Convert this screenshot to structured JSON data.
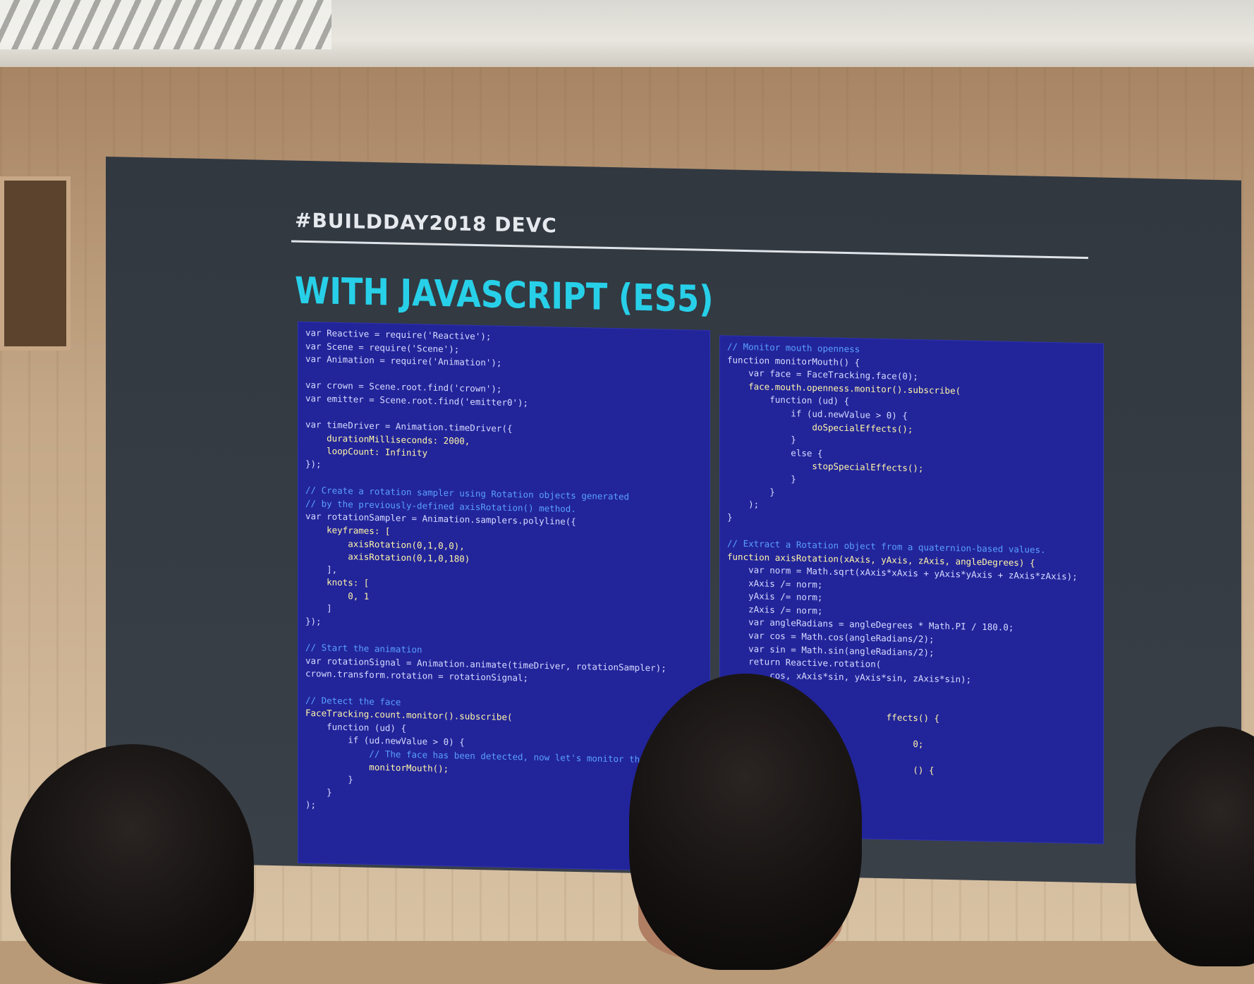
{
  "slide": {
    "hashtag": "#BUILDDAY2018 DEVC",
    "title": "WITH JAVASCRIPT (ES5)"
  },
  "left_code": [
    {
      "t": "var Reactive = require('Reactive');",
      "c": "kw"
    },
    {
      "t": "var Scene = require('Scene');",
      "c": "kw"
    },
    {
      "t": "var Animation = require('Animation');",
      "c": "kw"
    },
    {
      "t": "",
      "c": "bl"
    },
    {
      "t": "var crown = Scene.root.find('crown');",
      "c": "kw"
    },
    {
      "t": "var emitter = Scene.root.find('emitter0');",
      "c": "kw"
    },
    {
      "t": "",
      "c": "bl"
    },
    {
      "t": "var timeDriver = Animation.timeDriver({",
      "c": "kw"
    },
    {
      "t": "    durationMilliseconds: 2000,",
      "c": "fn"
    },
    {
      "t": "    loopCount: Infinity",
      "c": "fn"
    },
    {
      "t": "});",
      "c": "kw"
    },
    {
      "t": "",
      "c": "bl"
    },
    {
      "t": "// Create a rotation sampler using Rotation objects generated",
      "c": "cm"
    },
    {
      "t": "// by the previously-defined axisRotation() method.",
      "c": "cm"
    },
    {
      "t": "var rotationSampler = Animation.samplers.polyline({",
      "c": "kw"
    },
    {
      "t": "    keyframes: [",
      "c": "fn"
    },
    {
      "t": "        axisRotation(0,1,0,0),",
      "c": "fn"
    },
    {
      "t": "        axisRotation(0,1,0,180)",
      "c": "fn"
    },
    {
      "t": "    ],",
      "c": "kw"
    },
    {
      "t": "    knots: [",
      "c": "fn"
    },
    {
      "t": "        0, 1",
      "c": "fn"
    },
    {
      "t": "    ]",
      "c": "kw"
    },
    {
      "t": "});",
      "c": "kw"
    },
    {
      "t": "",
      "c": "bl"
    },
    {
      "t": "// Start the animation",
      "c": "cm"
    },
    {
      "t": "var rotationSignal = Animation.animate(timeDriver, rotationSampler);",
      "c": "kw"
    },
    {
      "t": "crown.transform.rotation = rotationSignal;",
      "c": "kw"
    },
    {
      "t": "",
      "c": "bl"
    },
    {
      "t": "// Detect the face",
      "c": "cm"
    },
    {
      "t": "FaceTracking.count.monitor().subscribe(",
      "c": "fn"
    },
    {
      "t": "    function (ud) {",
      "c": "kw"
    },
    {
      "t": "        if (ud.newValue > 0) {",
      "c": "kw"
    },
    {
      "t": "            // The face has been detected, now let's monitor the",
      "c": "cm"
    },
    {
      "t": "            monitorMouth();",
      "c": "fn"
    },
    {
      "t": "        }",
      "c": "kw"
    },
    {
      "t": "    }",
      "c": "kw"
    },
    {
      "t": ");",
      "c": "kw"
    }
  ],
  "right_code": [
    {
      "t": "// Monitor mouth openness",
      "c": "cm"
    },
    {
      "t": "function monitorMouth() {",
      "c": "kw"
    },
    {
      "t": "    var face = FaceTracking.face(0);",
      "c": "kw"
    },
    {
      "t": "    face.mouth.openness.monitor().subscribe(",
      "c": "fn"
    },
    {
      "t": "        function (ud) {",
      "c": "kw"
    },
    {
      "t": "            if (ud.newValue > 0) {",
      "c": "kw"
    },
    {
      "t": "                doSpecialEffects();",
      "c": "fn"
    },
    {
      "t": "            }",
      "c": "kw"
    },
    {
      "t": "            else {",
      "c": "kw"
    },
    {
      "t": "                stopSpecialEffects();",
      "c": "fn"
    },
    {
      "t": "            }",
      "c": "kw"
    },
    {
      "t": "        }",
      "c": "kw"
    },
    {
      "t": "    );",
      "c": "kw"
    },
    {
      "t": "}",
      "c": "kw"
    },
    {
      "t": "",
      "c": "bl"
    },
    {
      "t": "// Extract a Rotation object from a quaternion-based values.",
      "c": "cm"
    },
    {
      "t": "function axisRotation(xAxis, yAxis, zAxis, angleDegrees) {",
      "c": "fn"
    },
    {
      "t": "    var norm = Math.sqrt(xAxis*xAxis + yAxis*yAxis + zAxis*zAxis);",
      "c": "kw"
    },
    {
      "t": "    xAxis /= norm;",
      "c": "kw"
    },
    {
      "t": "    yAxis /= norm;",
      "c": "kw"
    },
    {
      "t": "    zAxis /= norm;",
      "c": "kw"
    },
    {
      "t": "    var angleRadians = angleDegrees * Math.PI / 180.0;",
      "c": "kw"
    },
    {
      "t": "    var cos = Math.cos(angleRadians/2);",
      "c": "kw"
    },
    {
      "t": "    var sin = Math.sin(angleRadians/2);",
      "c": "kw"
    },
    {
      "t": "    return Reactive.rotation(",
      "c": "kw"
    },
    {
      "t": "        cos, xAxis*sin, yAxis*sin, zAxis*sin);",
      "c": "kw"
    },
    {
      "t": "",
      "c": "bl"
    },
    {
      "t": "",
      "c": "bl"
    },
    {
      "t": "                              ffects() {",
      "c": "fn"
    },
    {
      "t": "",
      "c": "bl"
    },
    {
      "t": "                                   0;",
      "c": "fn"
    },
    {
      "t": "",
      "c": "bl"
    },
    {
      "t": "                                   () {",
      "c": "fn"
    }
  ]
}
